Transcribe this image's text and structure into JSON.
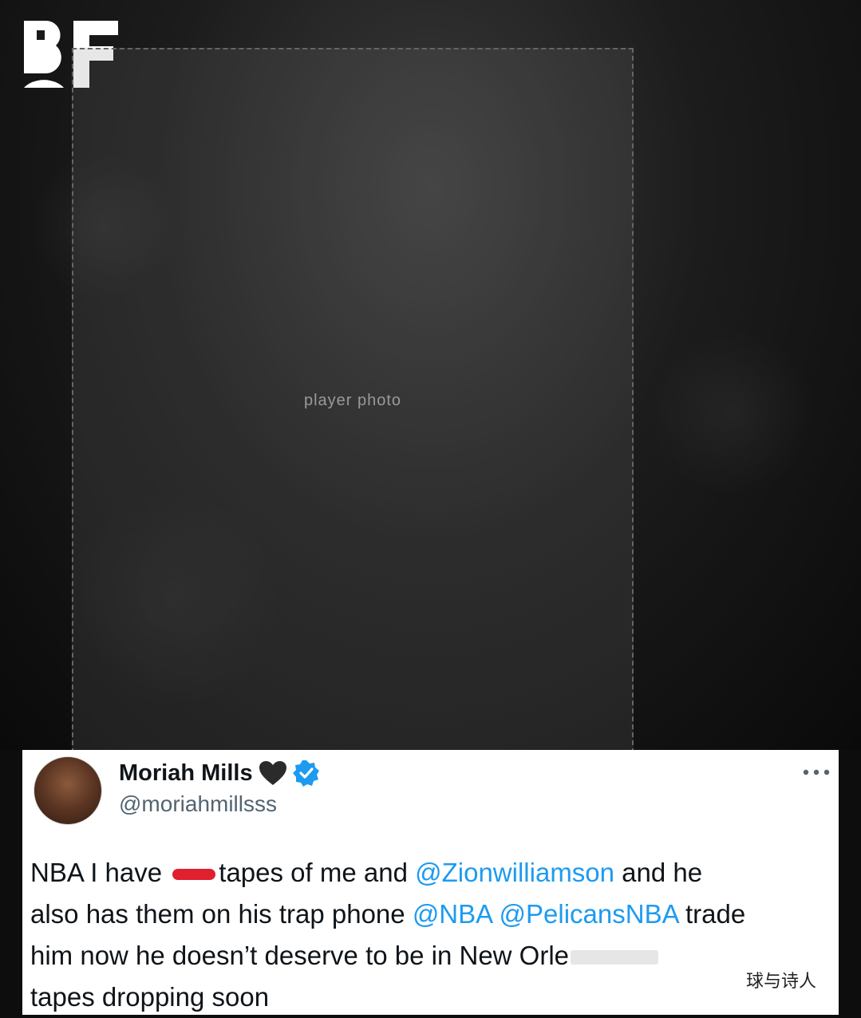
{
  "logo": {
    "text": "BF"
  },
  "photo": {
    "placeholder_label": "player photo"
  },
  "tweet": {
    "name": "Moriah Mills",
    "handle": "@moriahmillsss",
    "line1_a": "NBA I have",
    "line1_b": "tapes of me and",
    "mention_zion": "@Zionwilliamson",
    "line1_c": " and he",
    "line2_a": "also has them on his trap phone",
    "mention_nba": "@NBA",
    "mention_pelicans": "@PelicansNBA",
    "line2_b": "trade",
    "line3_a": "him now he doesn’t deserve to be in New Orle",
    "line4": "tapes dropping soon"
  },
  "watermark": "球与诗人"
}
